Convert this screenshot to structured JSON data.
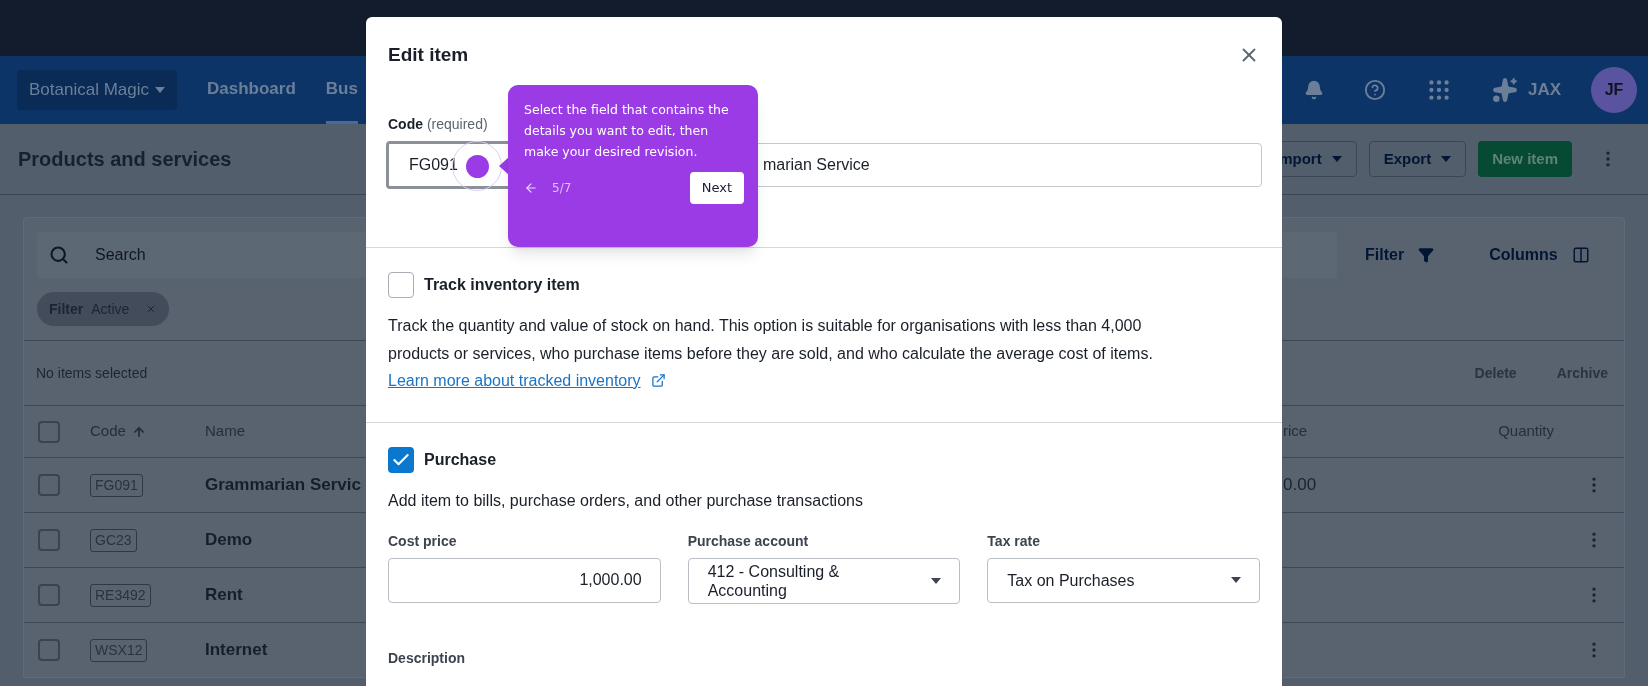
{
  "top_nav": {
    "org_switcher": "Botanical Magic",
    "items": [
      {
        "label": "Dashboard",
        "selected": false
      },
      {
        "label": "Bus",
        "selected": true
      }
    ],
    "assistant": "JAX",
    "avatar": "JF"
  },
  "page": {
    "title": "Products and services",
    "actions": [
      {
        "label": "mport",
        "kind": "menu"
      },
      {
        "label": "Export",
        "kind": "menu"
      },
      {
        "label": "New item",
        "kind": "primary"
      }
    ]
  },
  "table": {
    "search": {
      "placeholder": "Search"
    },
    "filter_button": "Filter",
    "columns_button": "Columns",
    "filter_chip": {
      "label": "Filter",
      "value": "Active"
    },
    "selection_status": "No items selected",
    "bulk_actions": [
      "Delete",
      "Archive"
    ],
    "all_checked": false,
    "columns": [
      {
        "label": "Code",
        "sorted": true
      },
      {
        "label": "Name",
        "sorted": false
      },
      {
        "label": "rice",
        "sorted": false
      },
      {
        "label": "Quantity",
        "sorted": false
      }
    ],
    "rows": [
      {
        "code": "FG091",
        "name": "Grammarian Servic",
        "price": "0.00",
        "checked": false
      },
      {
        "code": "GC23",
        "name": "Demo",
        "checked": false
      },
      {
        "code": "RE3492",
        "name": "Rent",
        "checked": false
      },
      {
        "code": "WSX12",
        "name": "Internet",
        "checked": false
      }
    ]
  },
  "modal": {
    "title": "Edit item",
    "code": {
      "label": "Code",
      "hint": "(required)",
      "value": "FG091",
      "focused": true
    },
    "name": {
      "value": "marian Service"
    },
    "track_inventory": {
      "label": "Track inventory item",
      "checked": false,
      "description": "Track the quantity and value of stock on hand. This option is suitable for organisations with less than 4,000 products or services, who purchase items before they are sold, and who calculate the average cost of items.",
      "link": "Learn more about tracked inventory"
    },
    "purchase": {
      "label": "Purchase",
      "checked": true,
      "description": "Add item to bills, purchase orders, and other purchase transactions",
      "fields": [
        {
          "label": "Cost price",
          "kind": "number",
          "value": "1,000.00"
        },
        {
          "label": "Purchase account",
          "kind": "select",
          "value": "412 - Consulting & Accounting"
        },
        {
          "label": "Tax rate",
          "kind": "select",
          "value": "Tax on Purchases"
        }
      ],
      "description_label": "Description"
    }
  },
  "tour_tooltip": {
    "text": "Select the field that contains the details you want to edit, then make your desired revision.",
    "step": "5/7",
    "next": "Next"
  }
}
